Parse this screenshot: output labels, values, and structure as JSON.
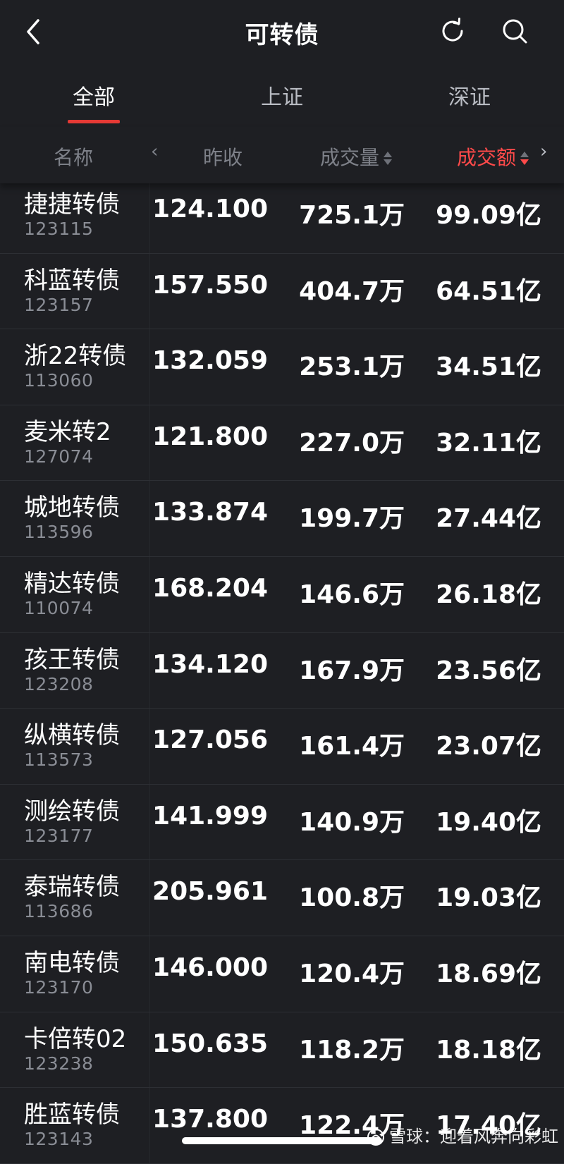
{
  "header": {
    "title": "可转债"
  },
  "tabs": [
    {
      "label": "全部",
      "active": true
    },
    {
      "label": "上证",
      "active": false
    },
    {
      "label": "深证",
      "active": false
    }
  ],
  "columns": {
    "name": "名称",
    "close": "昨收",
    "volume": "成交量",
    "amount": "成交额"
  },
  "rows": [
    {
      "name": "捷捷转债",
      "code": "123115",
      "close": "124.100",
      "volume": "725.1万",
      "amount": "99.09亿"
    },
    {
      "name": "科蓝转债",
      "code": "123157",
      "close": "157.550",
      "volume": "404.7万",
      "amount": "64.51亿"
    },
    {
      "name": "浙22转债",
      "code": "113060",
      "close": "132.059",
      "volume": "253.1万",
      "amount": "34.51亿"
    },
    {
      "name": "麦米转2",
      "code": "127074",
      "close": "121.800",
      "volume": "227.0万",
      "amount": "32.11亿"
    },
    {
      "name": "城地转债",
      "code": "113596",
      "close": "133.874",
      "volume": "199.7万",
      "amount": "27.44亿"
    },
    {
      "name": "精达转债",
      "code": "110074",
      "close": "168.204",
      "volume": "146.6万",
      "amount": "26.18亿"
    },
    {
      "name": "孩王转债",
      "code": "123208",
      "close": "134.120",
      "volume": "167.9万",
      "amount": "23.56亿"
    },
    {
      "name": "纵横转债",
      "code": "113573",
      "close": "127.056",
      "volume": "161.4万",
      "amount": "23.07亿"
    },
    {
      "name": "测绘转债",
      "code": "123177",
      "close": "141.999",
      "volume": "140.9万",
      "amount": "19.40亿"
    },
    {
      "name": "泰瑞转债",
      "code": "113686",
      "close": "205.961",
      "volume": "100.8万",
      "amount": "19.03亿"
    },
    {
      "name": "南电转债",
      "code": "123170",
      "close": "146.000",
      "volume": "120.4万",
      "amount": "18.69亿"
    },
    {
      "name": "卡倍转02",
      "code": "123238",
      "close": "150.635",
      "volume": "118.2万",
      "amount": "18.18亿"
    },
    {
      "name": "胜蓝转债",
      "code": "123143",
      "close": "137.800",
      "volume": "122.4万",
      "amount": "17.40亿"
    }
  ],
  "watermark": {
    "text": "雪球：迎着风奔向彩虹"
  },
  "colors": {
    "background": "#1e1f23",
    "accent_red": "#ff4a4a",
    "tab_underline": "#e53935",
    "muted_text": "#7e8189"
  },
  "icons": {
    "back": "back-arrow-icon",
    "refresh": "refresh-icon",
    "search": "search-icon",
    "sort": "sort-icon",
    "scroll_left": "chevron-left-icon",
    "scroll_right": "chevron-right-icon"
  }
}
